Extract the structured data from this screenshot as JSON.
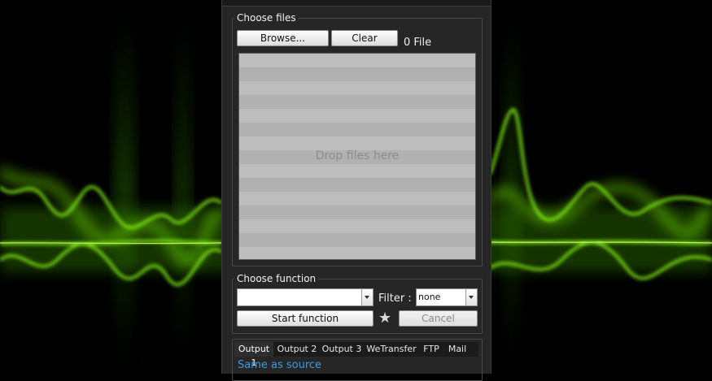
{
  "theme": {
    "accent": "#3d9ae0",
    "background_glow": "#7dff00",
    "panel": "#262626"
  },
  "choose_files": {
    "legend": "Choose files",
    "browse_label": "Browse...",
    "clear_label": "Clear",
    "file_count": "0 File",
    "drop_hint": "Drop files here"
  },
  "choose_function": {
    "legend": "Choose function",
    "function_select_value": "",
    "filter_label": "Filter :",
    "filter_select_value": "none",
    "start_label": "Start function",
    "cancel_label": "Cancel",
    "favorite_icon": "star-icon"
  },
  "output": {
    "tabs": [
      {
        "label": "Output 1",
        "active": true
      },
      {
        "label": "Output 2",
        "active": false
      },
      {
        "label": "Output 3",
        "active": false
      },
      {
        "label": "WeTransfer",
        "active": false
      },
      {
        "label": "FTP",
        "active": false
      },
      {
        "label": "Mail",
        "active": false
      }
    ],
    "value": "Same as source"
  }
}
